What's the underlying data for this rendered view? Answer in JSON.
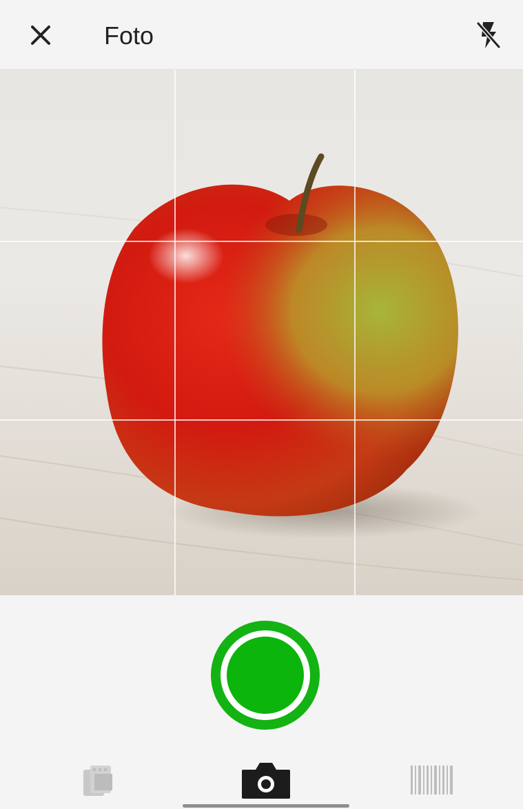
{
  "header": {
    "title": "Foto",
    "close_icon": "close-icon",
    "flash_icon": "flash-off-icon"
  },
  "viewfinder": {
    "subject": "apple-photo",
    "grid": "3x3"
  },
  "shutter": {
    "icon": "shutter-button",
    "color": "#12b312"
  },
  "modes": [
    {
      "name": "gallery",
      "icon": "gallery-icon",
      "active": false
    },
    {
      "name": "camera",
      "icon": "camera-icon",
      "active": true
    },
    {
      "name": "barcode",
      "icon": "barcode-icon",
      "active": false
    }
  ],
  "colors": {
    "accent": "#12b312",
    "background": "#f4f4f4",
    "text": "#222222"
  }
}
